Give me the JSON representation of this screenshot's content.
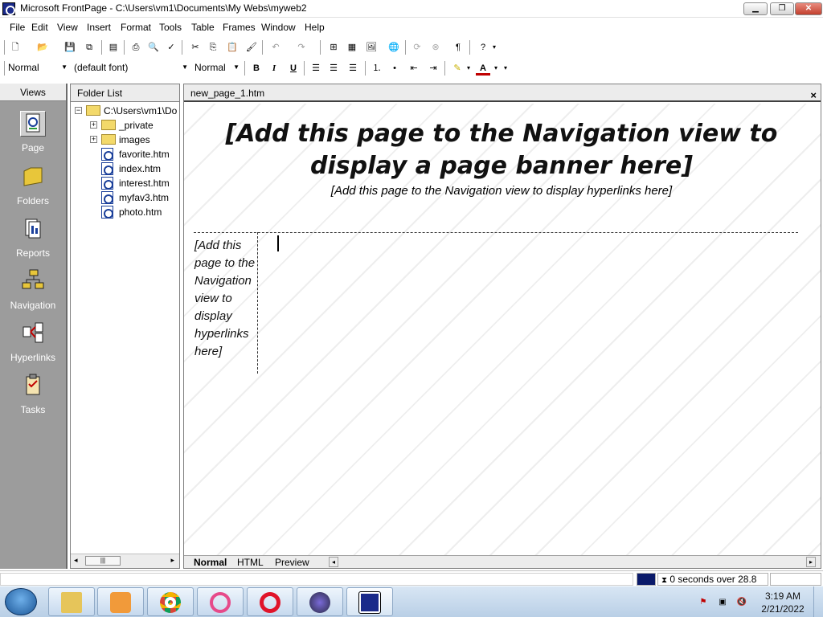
{
  "window": {
    "title": "Microsoft FrontPage - C:\\Users\\vm1\\Documents\\My Webs\\myweb2",
    "minimize": "▁",
    "restore": "❐",
    "close": "✕"
  },
  "menu": [
    "File",
    "Edit",
    "View",
    "Insert",
    "Format",
    "Tools",
    "Table",
    "Frames",
    "Window",
    "Help"
  ],
  "format_toolbar": {
    "style": "Normal",
    "font": "(default font)",
    "size": "Normal",
    "bold": "B",
    "italic": "I",
    "underline": "U"
  },
  "views": {
    "header": "Views",
    "items": [
      {
        "label": "Page",
        "icon": "page-view-icon"
      },
      {
        "label": "Folders",
        "icon": "folders-view-icon"
      },
      {
        "label": "Reports",
        "icon": "reports-view-icon"
      },
      {
        "label": "Navigation",
        "icon": "navigation-view-icon"
      },
      {
        "label": "Hyperlinks",
        "icon": "hyperlinks-view-icon"
      },
      {
        "label": "Tasks",
        "icon": "tasks-view-icon"
      }
    ]
  },
  "folder_list": {
    "header": "Folder List",
    "root": "C:\\Users\\vm1\\Do",
    "folders": [
      "_private",
      "images"
    ],
    "files": [
      "favorite.htm",
      "index.htm",
      "interest.htm",
      "myfav3.htm",
      "photo.htm"
    ]
  },
  "document": {
    "tab": "new_page_1.htm",
    "close": "×",
    "banner": "[Add this page to the Navigation view to display a page banner here]",
    "nav_top": "[Add this page to the Navigation view to display hyperlinks here]",
    "nav_left": "[Add this page to the Navigation view to display hyperlinks here]"
  },
  "view_tabs": [
    "Normal",
    "HTML",
    "Preview"
  ],
  "status": {
    "download": "0 seconds over 28.8"
  },
  "clock": {
    "time": "3:19 AM",
    "date": "2/21/2022"
  },
  "colors": {
    "views_bg": "#9c9c9c",
    "taskbar": "#c6d9ee"
  }
}
